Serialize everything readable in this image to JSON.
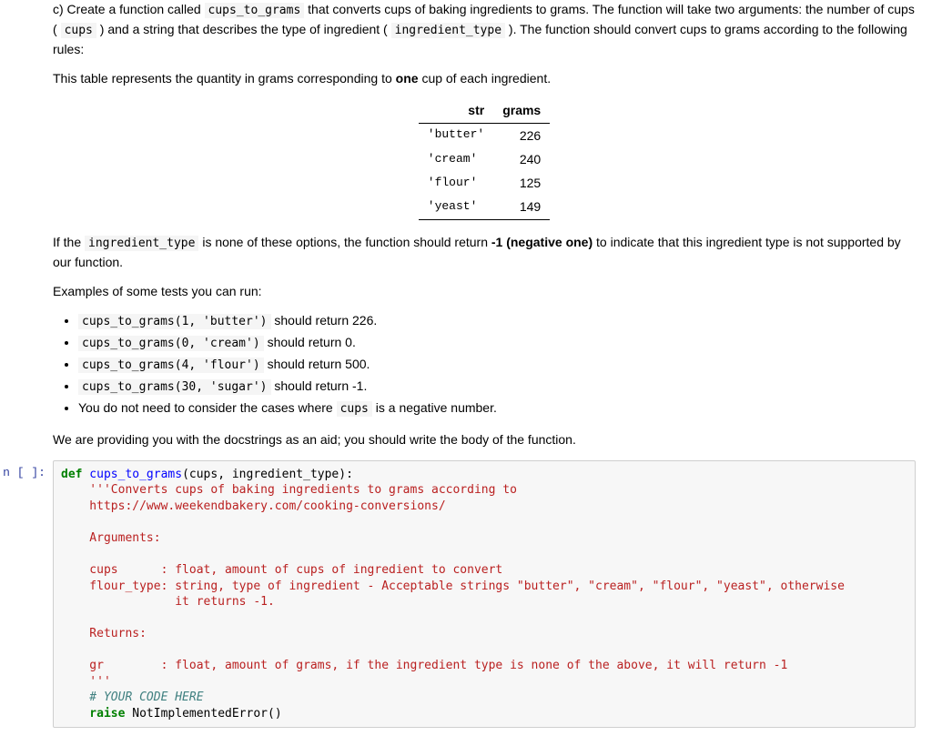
{
  "question": {
    "part_label": "c) Create a function called ",
    "fn_name": "cups_to_grams",
    "intro_after_fn": " that converts cups of baking ingredients to grams. The function will take two arguments: the number of cups ( ",
    "arg1": "cups",
    "between_args": " ) and a string that describes the type of ingredient ( ",
    "arg2": "ingredient_type",
    "after_args": " ). The function should convert cups to grams according to the following rules:"
  },
  "table_intro_a": "This table represents the quantity in grams corresponding to ",
  "table_intro_bold": "one",
  "table_intro_b": " cup of each ingredient.",
  "table": {
    "headers": [
      "str",
      "grams"
    ],
    "rows": [
      {
        "str": "'butter'",
        "grams": "226"
      },
      {
        "str": "'cream'",
        "grams": "240"
      },
      {
        "str": "'flour'",
        "grams": "125"
      },
      {
        "str": "'yeast'",
        "grams": "149"
      }
    ]
  },
  "fallback": {
    "a": "If the ",
    "code": "ingredient_type",
    "b": " is none of these options, the function should return ",
    "bold": "-1 (negative one)",
    "c": " to indicate that this ingredient type is not supported by our function."
  },
  "examples_label": "Examples of some tests you can run:",
  "tests": [
    {
      "code": "cups_to_grams(1, 'butter')",
      "after": " should return 226."
    },
    {
      "code": "cups_to_grams(0, 'cream')",
      "after": " should return 0."
    },
    {
      "code": "cups_to_grams(4, 'flour')",
      "after": " should return 500."
    },
    {
      "code": "cups_to_grams(30, 'sugar')",
      "after": " should return -1."
    }
  ],
  "tests_note_a": "You do not need to consider the cases where ",
  "tests_note_code": "cups",
  "tests_note_b": " is a negative number.",
  "docstring_note": "We are providing you with the docstrings as an aid; you should write the body of the function.",
  "cell": {
    "prompt_n": "n",
    "prompt_br": "[ ]:",
    "code": {
      "l01_def": "def",
      "l01_fn": " cups_to_grams",
      "l01_rest": "(cups, ingredient_type):",
      "l02": "    '''Converts cups of baking ingredients to grams according to",
      "l03": "    https://www.weekendbakery.com/cooking-conversions/",
      "l04": "",
      "l05": "    Arguments:",
      "l06": "",
      "l07": "    cups      : float, amount of cups of ingredient to convert",
      "l08": "    flour_type: string, type of ingredient - Acceptable strings \"butter\", \"cream\", \"flour\", \"yeast\", otherwise",
      "l09": "                it returns -1.",
      "l10": "",
      "l11": "    Returns:",
      "l12": "",
      "l13": "    gr        : float, amount of grams, if the ingredient type is none of the above, it will return -1",
      "l14": "    '''",
      "l15": "    # YOUR CODE HERE",
      "l16_kw": "    raise",
      "l16_rest": " NotImplementedError()"
    }
  }
}
